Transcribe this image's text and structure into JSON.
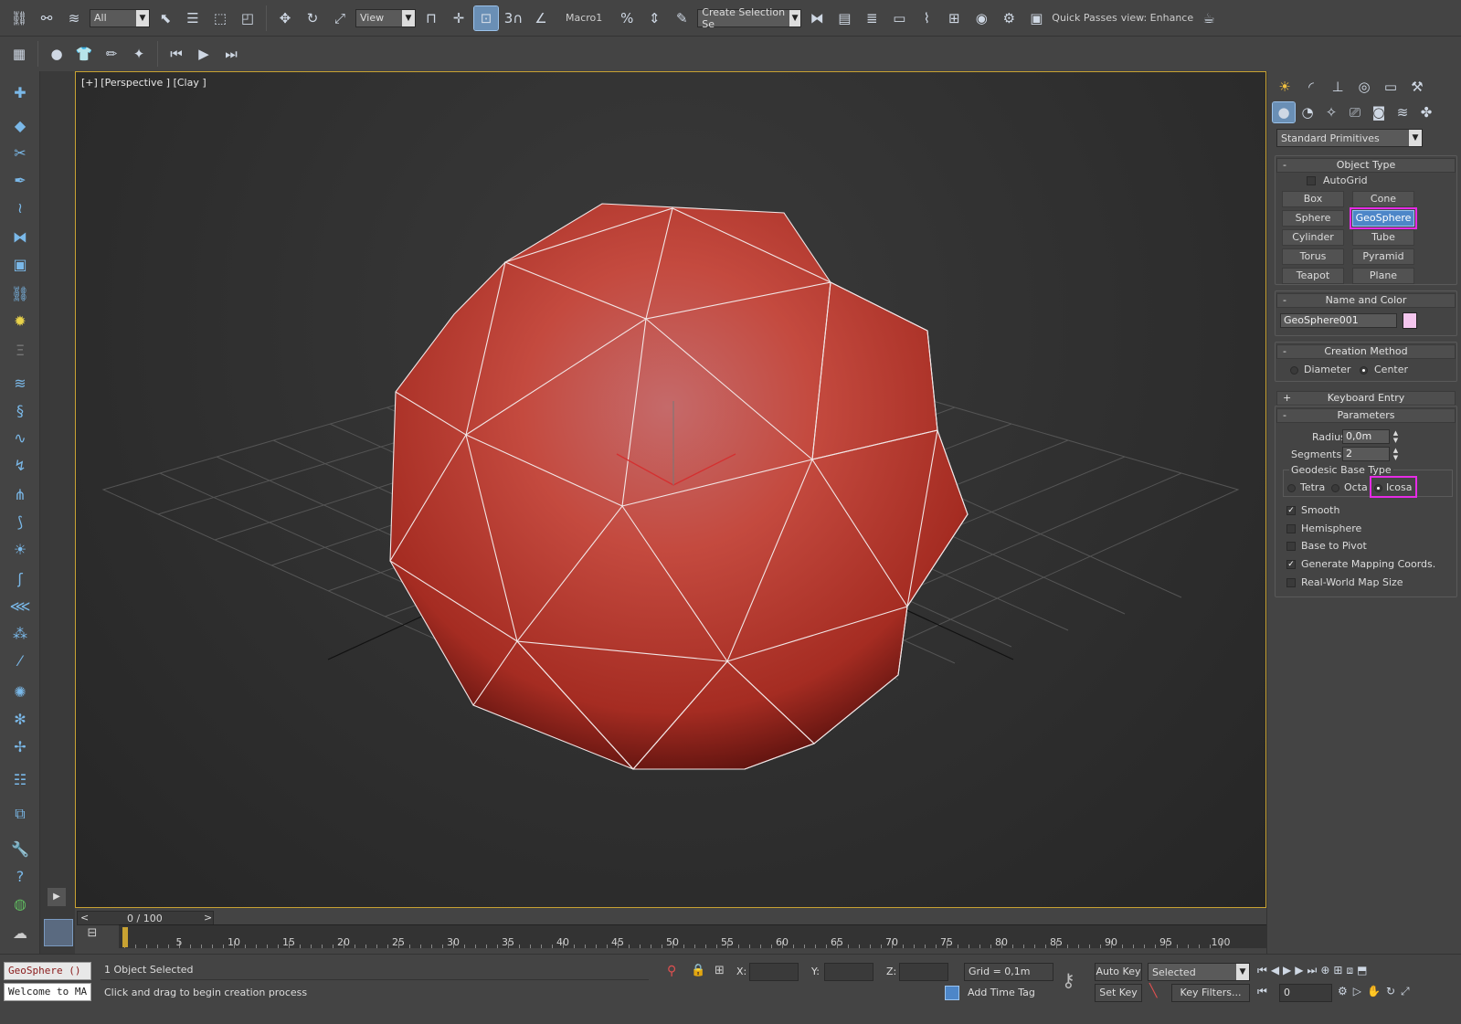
{
  "toolbar": {
    "selection_filter": "All",
    "reference_coord": "View",
    "snap_value": "3",
    "macro_label": "Macro1",
    "named_selection_placeholder": "Create Selection Se",
    "quick_passes": "Quick Passes",
    "view_label": "view: Enhance"
  },
  "viewport": {
    "label": "[+] [Perspective ] [Clay ]"
  },
  "command_panel": {
    "category_dropdown": "Standard Primitives",
    "object_type": {
      "title": "Object Type",
      "autogrid": "AutoGrid",
      "buttons": [
        "Box",
        "Cone",
        "Sphere",
        "GeoSphere",
        "Cylinder",
        "Tube",
        "Torus",
        "Pyramid",
        "Teapot",
        "Plane"
      ]
    },
    "name_and_color": {
      "title": "Name and Color",
      "name": "GeoSphere001",
      "color": "#f4c6ee"
    },
    "creation_method": {
      "title": "Creation Method",
      "diameter": "Diameter",
      "center": "Center"
    },
    "keyboard_entry": {
      "title": "Keyboard Entry"
    },
    "parameters": {
      "title": "Parameters",
      "radius_label": "Radius:",
      "radius_value": "0,0m",
      "segments_label": "Segments:",
      "segments_value": "2",
      "geodesic_title": "Geodesic Base Type",
      "tetra": "Tetra",
      "octa": "Octa",
      "icosa": "Icosa",
      "smooth": "Smooth",
      "hemisphere": "Hemisphere",
      "base_to_pivot": "Base to Pivot",
      "gen_mapping": "Generate Mapping Coords.",
      "real_world": "Real-World Map Size"
    }
  },
  "timeline": {
    "frame_counter": "0 / 100",
    "prev": "<",
    "next": ">",
    "ticks": [
      "0",
      "5",
      "10",
      "15",
      "20",
      "25",
      "30",
      "35",
      "40",
      "45",
      "50",
      "55",
      "60",
      "65",
      "70",
      "75",
      "80",
      "85",
      "90",
      "95",
      "100"
    ]
  },
  "status": {
    "maxscript_1": "GeoSphere  ()",
    "maxscript_2": "Welcome to MA",
    "selection_count": "1 Object Selected",
    "prompt": "Click and drag to begin creation process",
    "x_label": "X:",
    "y_label": "Y:",
    "z_label": "Z:",
    "grid": "Grid = 0,1m",
    "add_time_tag": "Add Time Tag",
    "auto_key": "Auto Key",
    "set_key": "Set Key",
    "key_mode": "Selected",
    "key_filters": "Key Filters...",
    "current_frame": "0"
  },
  "colors": {
    "accent_highlight": "#e62be6",
    "selected_button": "#4d86c8",
    "viewport_border": "#c8a232",
    "sphere": "#c2433a"
  }
}
